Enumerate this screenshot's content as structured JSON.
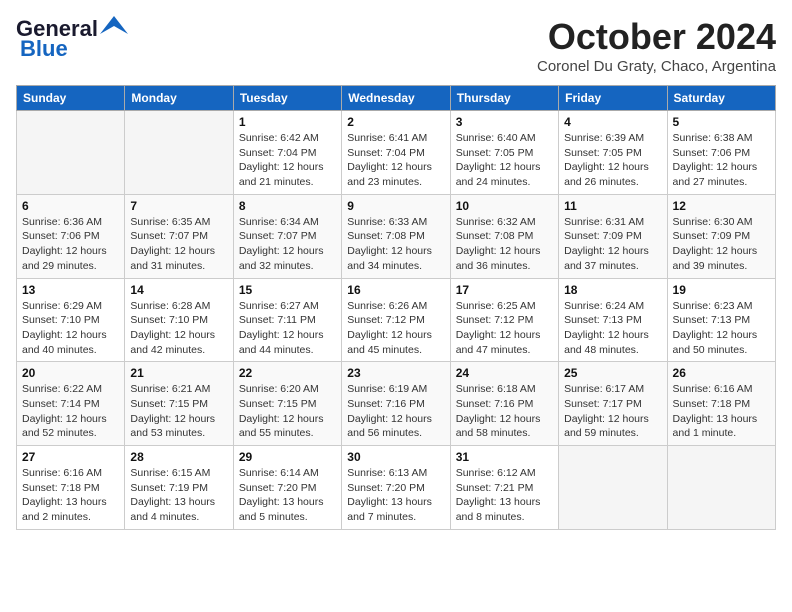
{
  "header": {
    "logo_line1": "General",
    "logo_line2": "Blue",
    "month": "October 2024",
    "location": "Coronel Du Graty, Chaco, Argentina"
  },
  "days_of_week": [
    "Sunday",
    "Monday",
    "Tuesday",
    "Wednesday",
    "Thursday",
    "Friday",
    "Saturday"
  ],
  "weeks": [
    [
      {
        "day": "",
        "sunrise": "",
        "sunset": "",
        "daylight": "",
        "empty": true
      },
      {
        "day": "",
        "sunrise": "",
        "sunset": "",
        "daylight": "",
        "empty": true
      },
      {
        "day": "1",
        "sunrise": "Sunrise: 6:42 AM",
        "sunset": "Sunset: 7:04 PM",
        "daylight": "Daylight: 12 hours and 21 minutes."
      },
      {
        "day": "2",
        "sunrise": "Sunrise: 6:41 AM",
        "sunset": "Sunset: 7:04 PM",
        "daylight": "Daylight: 12 hours and 23 minutes."
      },
      {
        "day": "3",
        "sunrise": "Sunrise: 6:40 AM",
        "sunset": "Sunset: 7:05 PM",
        "daylight": "Daylight: 12 hours and 24 minutes."
      },
      {
        "day": "4",
        "sunrise": "Sunrise: 6:39 AM",
        "sunset": "Sunset: 7:05 PM",
        "daylight": "Daylight: 12 hours and 26 minutes."
      },
      {
        "day": "5",
        "sunrise": "Sunrise: 6:38 AM",
        "sunset": "Sunset: 7:06 PM",
        "daylight": "Daylight: 12 hours and 27 minutes."
      }
    ],
    [
      {
        "day": "6",
        "sunrise": "Sunrise: 6:36 AM",
        "sunset": "Sunset: 7:06 PM",
        "daylight": "Daylight: 12 hours and 29 minutes."
      },
      {
        "day": "7",
        "sunrise": "Sunrise: 6:35 AM",
        "sunset": "Sunset: 7:07 PM",
        "daylight": "Daylight: 12 hours and 31 minutes."
      },
      {
        "day": "8",
        "sunrise": "Sunrise: 6:34 AM",
        "sunset": "Sunset: 7:07 PM",
        "daylight": "Daylight: 12 hours and 32 minutes."
      },
      {
        "day": "9",
        "sunrise": "Sunrise: 6:33 AM",
        "sunset": "Sunset: 7:08 PM",
        "daylight": "Daylight: 12 hours and 34 minutes."
      },
      {
        "day": "10",
        "sunrise": "Sunrise: 6:32 AM",
        "sunset": "Sunset: 7:08 PM",
        "daylight": "Daylight: 12 hours and 36 minutes."
      },
      {
        "day": "11",
        "sunrise": "Sunrise: 6:31 AM",
        "sunset": "Sunset: 7:09 PM",
        "daylight": "Daylight: 12 hours and 37 minutes."
      },
      {
        "day": "12",
        "sunrise": "Sunrise: 6:30 AM",
        "sunset": "Sunset: 7:09 PM",
        "daylight": "Daylight: 12 hours and 39 minutes."
      }
    ],
    [
      {
        "day": "13",
        "sunrise": "Sunrise: 6:29 AM",
        "sunset": "Sunset: 7:10 PM",
        "daylight": "Daylight: 12 hours and 40 minutes."
      },
      {
        "day": "14",
        "sunrise": "Sunrise: 6:28 AM",
        "sunset": "Sunset: 7:10 PM",
        "daylight": "Daylight: 12 hours and 42 minutes."
      },
      {
        "day": "15",
        "sunrise": "Sunrise: 6:27 AM",
        "sunset": "Sunset: 7:11 PM",
        "daylight": "Daylight: 12 hours and 44 minutes."
      },
      {
        "day": "16",
        "sunrise": "Sunrise: 6:26 AM",
        "sunset": "Sunset: 7:12 PM",
        "daylight": "Daylight: 12 hours and 45 minutes."
      },
      {
        "day": "17",
        "sunrise": "Sunrise: 6:25 AM",
        "sunset": "Sunset: 7:12 PM",
        "daylight": "Daylight: 12 hours and 47 minutes."
      },
      {
        "day": "18",
        "sunrise": "Sunrise: 6:24 AM",
        "sunset": "Sunset: 7:13 PM",
        "daylight": "Daylight: 12 hours and 48 minutes."
      },
      {
        "day": "19",
        "sunrise": "Sunrise: 6:23 AM",
        "sunset": "Sunset: 7:13 PM",
        "daylight": "Daylight: 12 hours and 50 minutes."
      }
    ],
    [
      {
        "day": "20",
        "sunrise": "Sunrise: 6:22 AM",
        "sunset": "Sunset: 7:14 PM",
        "daylight": "Daylight: 12 hours and 52 minutes."
      },
      {
        "day": "21",
        "sunrise": "Sunrise: 6:21 AM",
        "sunset": "Sunset: 7:15 PM",
        "daylight": "Daylight: 12 hours and 53 minutes."
      },
      {
        "day": "22",
        "sunrise": "Sunrise: 6:20 AM",
        "sunset": "Sunset: 7:15 PM",
        "daylight": "Daylight: 12 hours and 55 minutes."
      },
      {
        "day": "23",
        "sunrise": "Sunrise: 6:19 AM",
        "sunset": "Sunset: 7:16 PM",
        "daylight": "Daylight: 12 hours and 56 minutes."
      },
      {
        "day": "24",
        "sunrise": "Sunrise: 6:18 AM",
        "sunset": "Sunset: 7:16 PM",
        "daylight": "Daylight: 12 hours and 58 minutes."
      },
      {
        "day": "25",
        "sunrise": "Sunrise: 6:17 AM",
        "sunset": "Sunset: 7:17 PM",
        "daylight": "Daylight: 12 hours and 59 minutes."
      },
      {
        "day": "26",
        "sunrise": "Sunrise: 6:16 AM",
        "sunset": "Sunset: 7:18 PM",
        "daylight": "Daylight: 13 hours and 1 minute."
      }
    ],
    [
      {
        "day": "27",
        "sunrise": "Sunrise: 6:16 AM",
        "sunset": "Sunset: 7:18 PM",
        "daylight": "Daylight: 13 hours and 2 minutes."
      },
      {
        "day": "28",
        "sunrise": "Sunrise: 6:15 AM",
        "sunset": "Sunset: 7:19 PM",
        "daylight": "Daylight: 13 hours and 4 minutes."
      },
      {
        "day": "29",
        "sunrise": "Sunrise: 6:14 AM",
        "sunset": "Sunset: 7:20 PM",
        "daylight": "Daylight: 13 hours and 5 minutes."
      },
      {
        "day": "30",
        "sunrise": "Sunrise: 6:13 AM",
        "sunset": "Sunset: 7:20 PM",
        "daylight": "Daylight: 13 hours and 7 minutes."
      },
      {
        "day": "31",
        "sunrise": "Sunrise: 6:12 AM",
        "sunset": "Sunset: 7:21 PM",
        "daylight": "Daylight: 13 hours and 8 minutes."
      },
      {
        "day": "",
        "sunrise": "",
        "sunset": "",
        "daylight": "",
        "empty": true
      },
      {
        "day": "",
        "sunrise": "",
        "sunset": "",
        "daylight": "",
        "empty": true
      }
    ]
  ]
}
